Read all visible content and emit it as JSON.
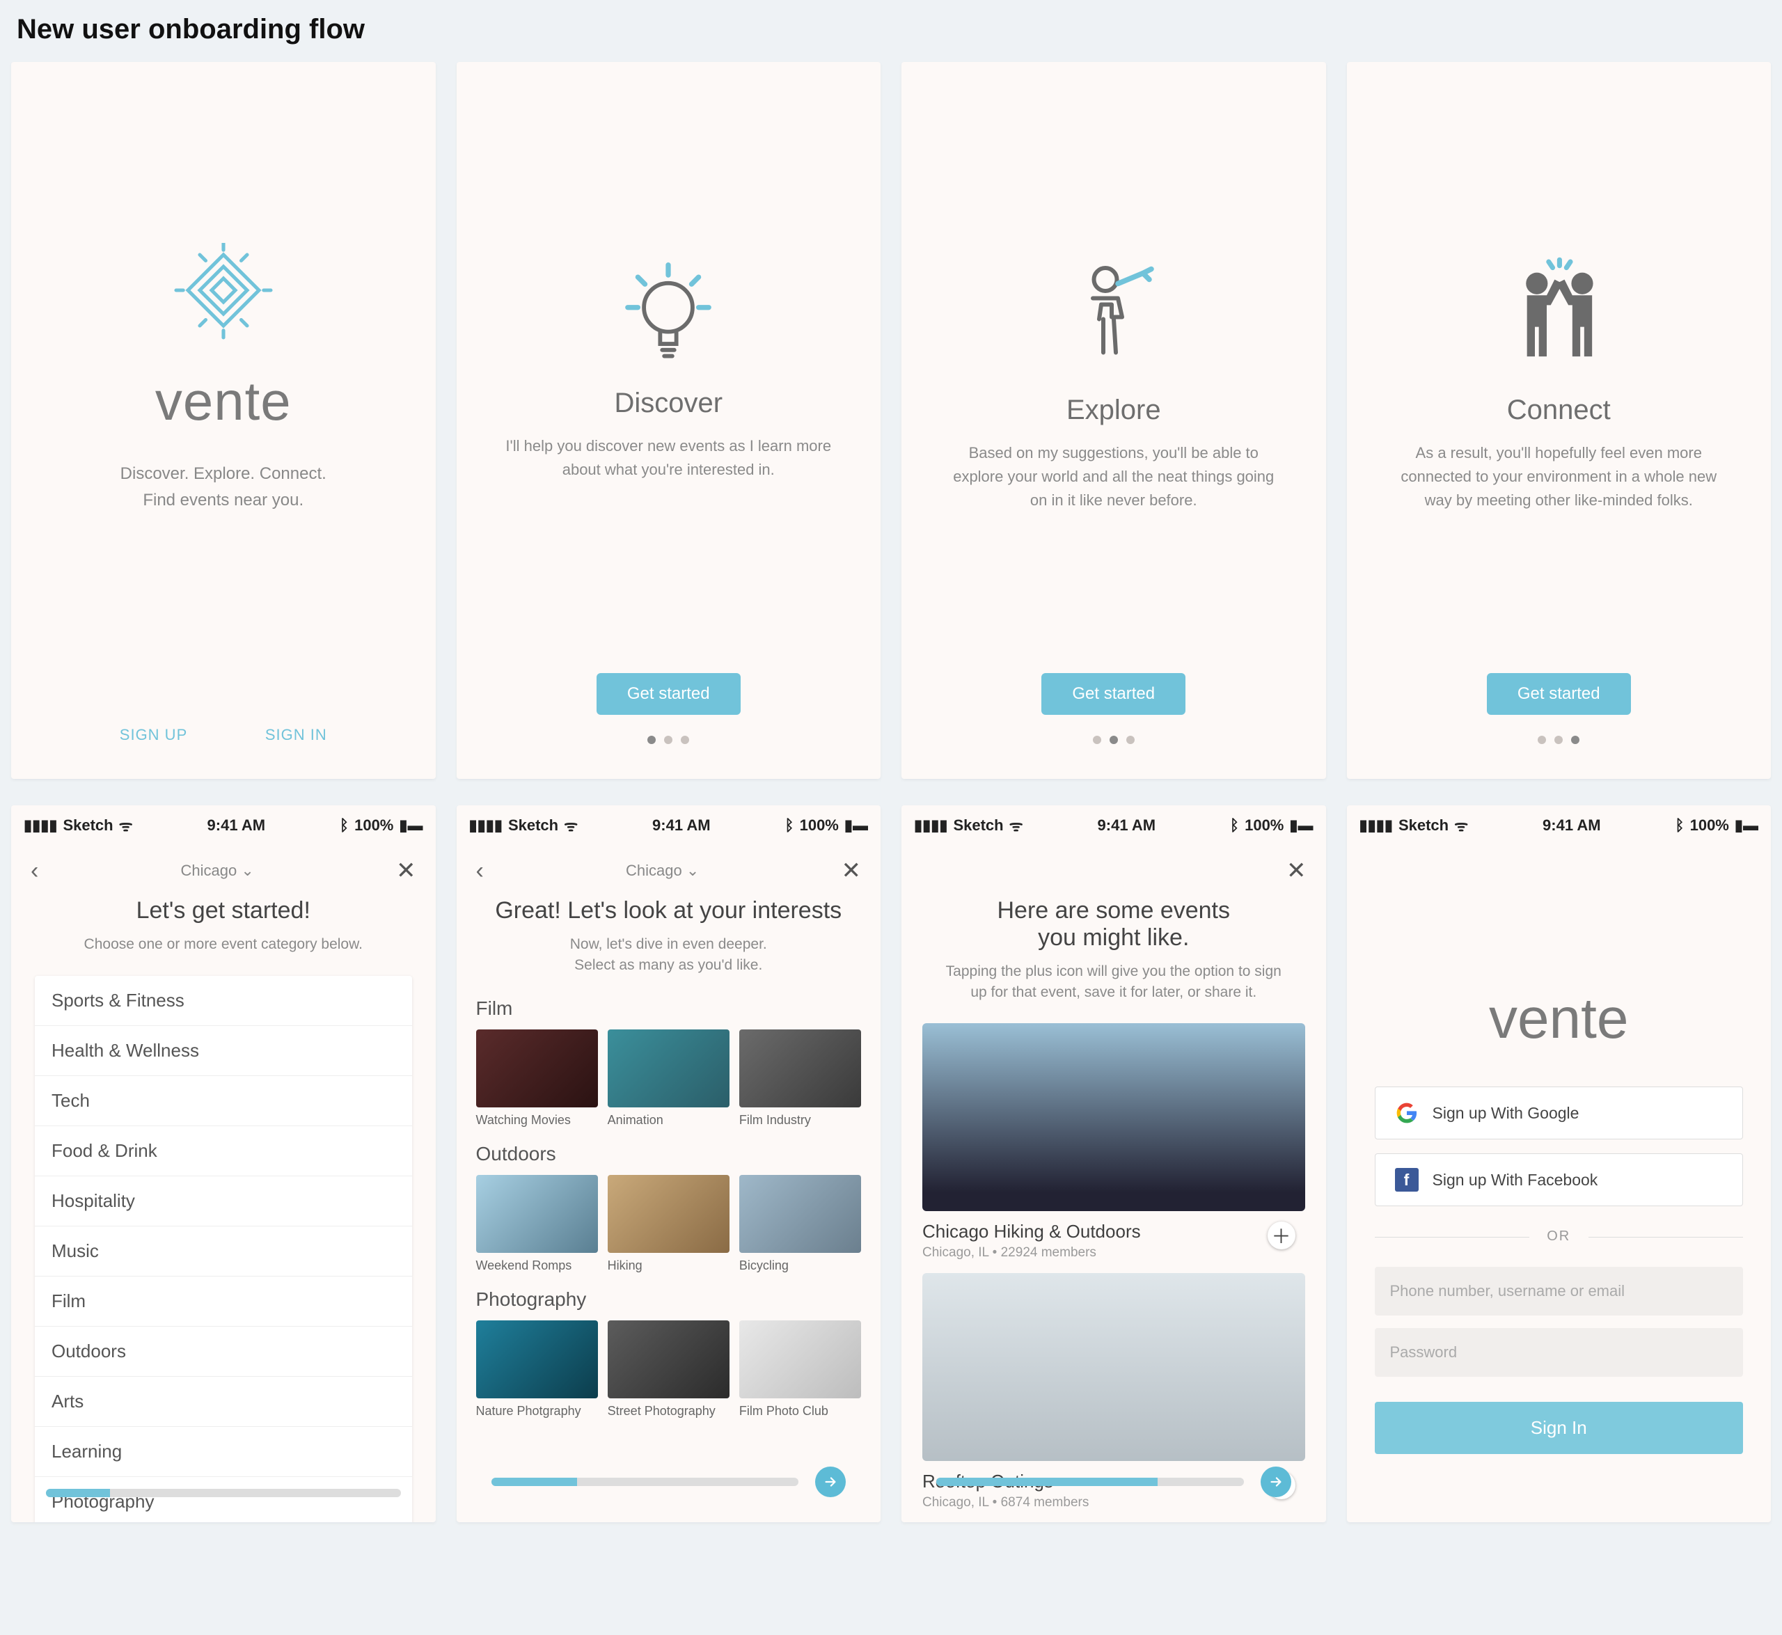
{
  "page_title": "New user onboarding flow",
  "accent": "#71c3da",
  "status": {
    "carrier": "Sketch",
    "time": "9:41 AM",
    "battery": "100%"
  },
  "welcome": {
    "brand": "vente",
    "tagline1": "Discover. Explore. Connect.",
    "tagline2": "Find events near you.",
    "signup": "SIGN UP",
    "signin": "SIGN IN"
  },
  "onb": [
    {
      "title": "Discover",
      "body": "I'll help you discover new events as I learn more about what you're interested in.",
      "cta": "Get started",
      "active_dot": 0
    },
    {
      "title": "Explore",
      "body": "Based on my suggestions, you'll be able to explore your world and all the neat things going on in it like never before.",
      "cta": "Get started",
      "active_dot": 1
    },
    {
      "title": "Connect",
      "body": "As a result, you'll hopefully feel even more connected to your environment in a whole new way by meeting other like-minded folks.",
      "cta": "Get started",
      "active_dot": 2
    }
  ],
  "step1": {
    "city": "Chicago",
    "title": "Let's get started!",
    "sub": "Choose one or more event category below.",
    "categories": [
      "Sports & Fitness",
      "Health & Wellness",
      "Tech",
      "Food & Drink",
      "Hospitality",
      "Music",
      "Film",
      "Outdoors",
      "Arts",
      "Learning",
      "Photography"
    ],
    "progress": 18
  },
  "step2": {
    "city": "Chicago",
    "title": "Great! Let's look at your interests",
    "sub1": "Now, let's dive in even deeper.",
    "sub2": "Select  as many as you'd like.",
    "groups": [
      {
        "name": "Film",
        "tiles": [
          "Watching  Movies",
          "Animation",
          "Film Industry"
        ]
      },
      {
        "name": "Outdoors",
        "tiles": [
          "Weekend Romps",
          "Hiking",
          "Bicycling"
        ]
      },
      {
        "name": "Photography",
        "tiles": [
          "Nature Photgraphy",
          "Street Photography",
          "Film Photo Club"
        ]
      }
    ],
    "progress": 28
  },
  "step3": {
    "title1": "Here are some events",
    "title2": "you might like.",
    "sub": "Tapping the plus icon will give you the option to sign up for that event, save it for later, or share it.",
    "events": [
      {
        "name": "Chicago Hiking & Outdoors",
        "meta": "Chicago, IL • 22924 members"
      },
      {
        "name": "Rooftop Outings",
        "meta": "Chicago, IL • 6874 members"
      }
    ],
    "progress": 72
  },
  "signin": {
    "brand": "vente",
    "google": "Sign up With Google",
    "facebook": "Sign up With Facebook",
    "or": "OR",
    "ph_user": "Phone number, username or email",
    "ph_pass": "Password",
    "submit": "Sign In"
  }
}
